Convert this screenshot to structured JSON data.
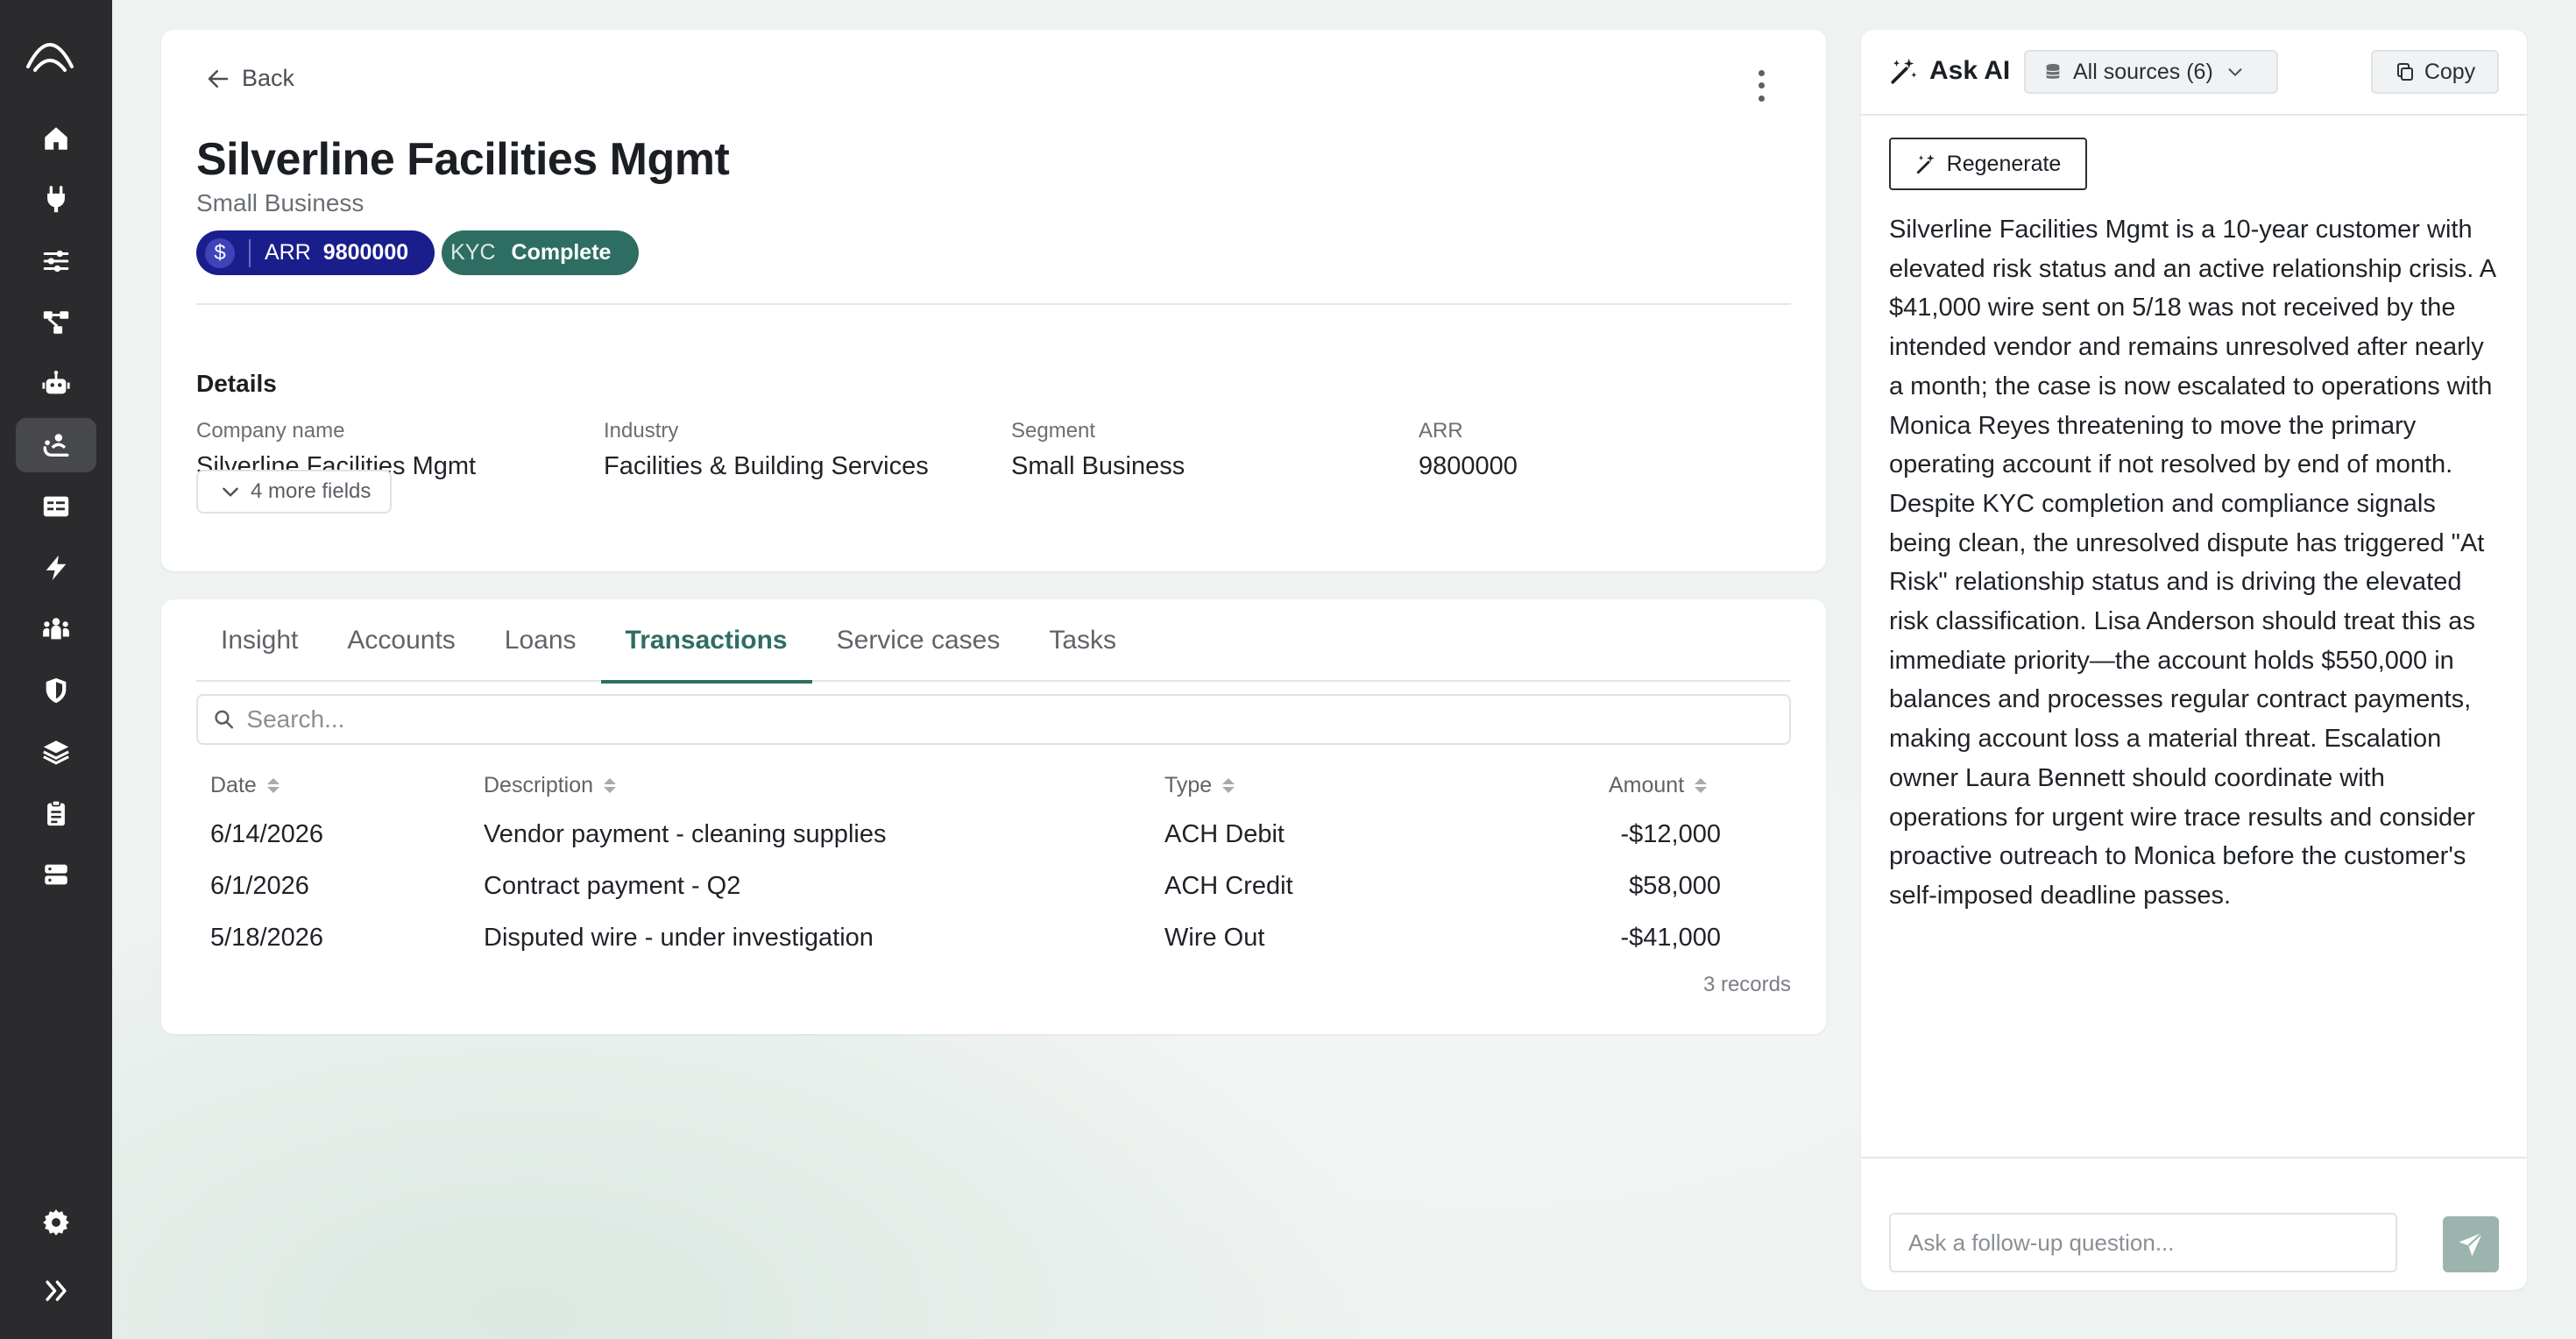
{
  "sidebar": {
    "logo": "app-logo-icon",
    "items": [
      {
        "icon": "home-icon"
      },
      {
        "icon": "plug-icon"
      },
      {
        "icon": "sliders-icon"
      },
      {
        "icon": "workflow-icon"
      },
      {
        "icon": "robot-icon"
      },
      {
        "icon": "relationship-icon",
        "active": true
      },
      {
        "icon": "id-card-icon"
      },
      {
        "icon": "lightning-icon"
      },
      {
        "icon": "team-icon"
      },
      {
        "icon": "shield-icon"
      },
      {
        "icon": "layers-icon"
      },
      {
        "icon": "clipboard-icon"
      },
      {
        "icon": "server-icon"
      }
    ],
    "bottom": [
      {
        "icon": "gear-icon"
      },
      {
        "icon": "expand-icon"
      }
    ]
  },
  "header": {
    "back_label": "Back",
    "company_name": "Silverline Facilities Mgmt",
    "company_type": "Small Business",
    "badges": {
      "arr_symbol": "$",
      "arr_label": "ARR",
      "arr_value": "9800000",
      "kyc_label": "KYC",
      "kyc_value": "Complete"
    }
  },
  "details": {
    "title": "Details",
    "fields": [
      {
        "label": "Company name",
        "value": "Silverline Facilities Mgmt"
      },
      {
        "label": "Industry",
        "value": "Facilities & Building Services"
      },
      {
        "label": "Segment",
        "value": "Small Business"
      },
      {
        "label": "ARR",
        "value": "9800000"
      }
    ],
    "more_fields_label": "4 more fields"
  },
  "tabs": [
    {
      "label": "Insight"
    },
    {
      "label": "Accounts"
    },
    {
      "label": "Loans"
    },
    {
      "label": "Transactions",
      "active": true
    },
    {
      "label": "Service cases"
    },
    {
      "label": "Tasks"
    }
  ],
  "transactions": {
    "search_placeholder": "Search...",
    "columns": [
      "Date",
      "Description",
      "Type",
      "Amount"
    ],
    "rows": [
      {
        "date": "6/14/2026",
        "description": "Vendor payment - cleaning supplies",
        "type": "ACH Debit",
        "amount": "-$12,000"
      },
      {
        "date": "6/1/2026",
        "description": "Contract payment - Q2",
        "type": "ACH Credit",
        "amount": "$58,000"
      },
      {
        "date": "5/18/2026",
        "description": "Disputed wire - under investigation",
        "type": "Wire Out",
        "amount": "-$41,000"
      }
    ],
    "records_label": "3 records"
  },
  "ai": {
    "title": "Ask AI",
    "sources_label": "All sources (6)",
    "copy_label": "Copy",
    "regenerate_label": "Regenerate",
    "summary": "Silverline Facilities Mgmt is a 10-year customer with elevated risk status and an active relationship crisis. A $41,000 wire sent on 5/18 was not received by the intended vendor and remains unresolved after nearly a month; the case is now escalated to operations with Monica Reyes threatening to move the primary operating account if not resolved by end of month. Despite KYC completion and compliance signals being clean, the unresolved dispute has triggered \"At Risk\" relationship status and is driving the elevated risk classification. Lisa Anderson should treat this as immediate priority—the account holds $550,000 in balances and processes regular contract payments, making account loss a material threat. Escalation owner Laura Bennett should coordinate with operations for urgent wire trace results and consider proactive outreach to Monica before the customer's self-imposed deadline passes.",
    "followup_placeholder": "Ask a follow-up question..."
  },
  "colors": {
    "sidebar_bg": "#2b2b2d",
    "accent": "#2e6e62",
    "arr_badge": "#1a1e8c",
    "send_button": "#9bb4ae"
  }
}
